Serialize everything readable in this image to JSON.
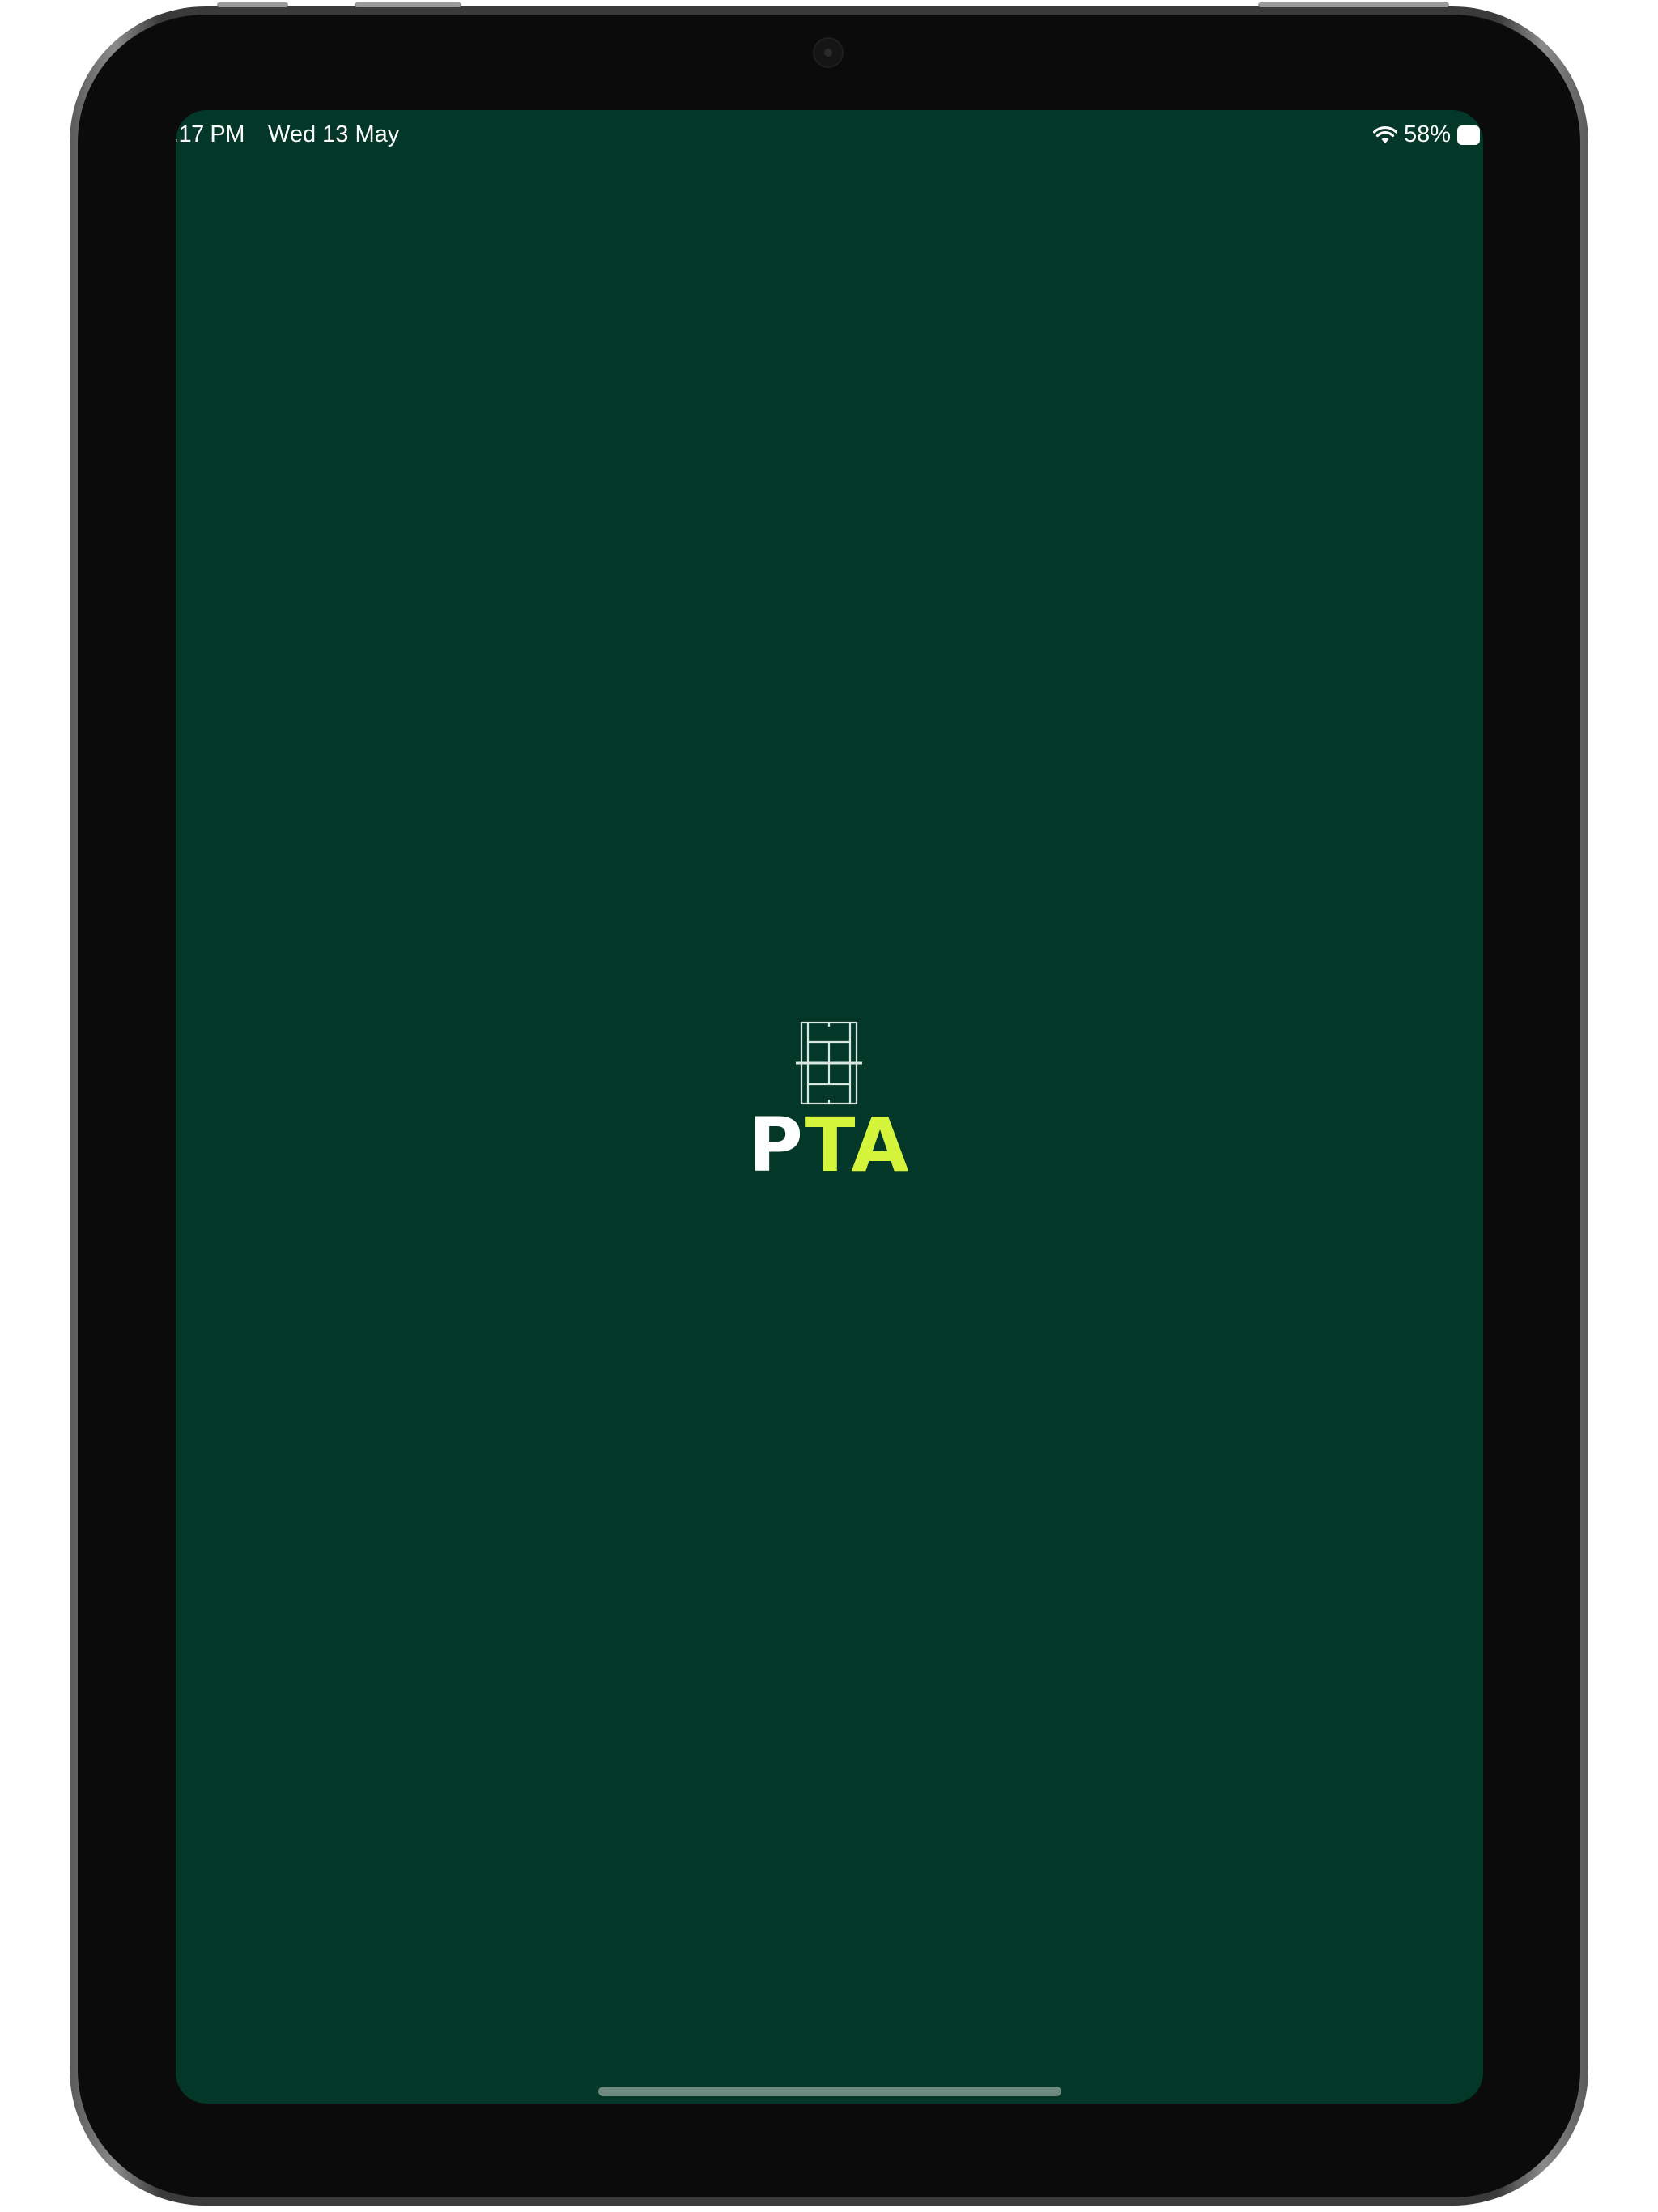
{
  "status_bar": {
    "time": ":17 PM",
    "date": "Wed 13 May",
    "battery_percent": "58%",
    "battery_level": 0.58
  },
  "splash": {
    "logo_text_first": "P",
    "logo_text_rest": "TA",
    "icon": "tennis-court-icon"
  },
  "colors": {
    "background": "#033728",
    "accent": "#d4f53c",
    "bezel": "#0b0b0b"
  }
}
